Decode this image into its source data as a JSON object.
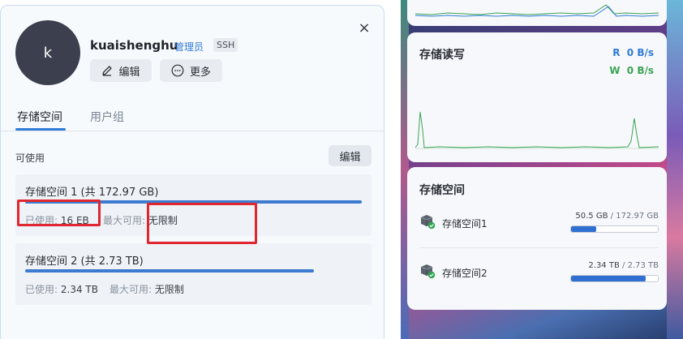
{
  "user_panel": {
    "avatar_letter": "k",
    "username": "kuaishenghu",
    "role_tag": "管理员",
    "ssh_tag": "SSH",
    "close_symbol": "×",
    "edit_button": "编辑",
    "more_button": "更多",
    "tabs": [
      {
        "label": "存储空间",
        "active": true
      },
      {
        "label": "用户组",
        "active": false
      }
    ],
    "available_label": "可使用",
    "edit_small_button": "编辑",
    "storage": [
      {
        "title": "存储空间 1 (共 172.97 GB)",
        "used_label": "已使用:",
        "used_value": "16 EB",
        "max_label": "最大可用:",
        "max_value": "无限制",
        "bar_fraction": 0.95
      },
      {
        "title": "存储空间 2 (共 2.73 TB)",
        "used_label": "已使用:",
        "used_value": "2.34 TB",
        "max_label": "最大可用:",
        "max_value": "无限制",
        "bar_fraction": 0.81
      }
    ]
  },
  "dashboard": {
    "io_widget": {
      "title": "存储读写",
      "read_label": "R",
      "read_value": "0 B/s",
      "write_label": "W",
      "write_value": "0 B/s"
    },
    "storage_widget": {
      "title": "存储空间",
      "volumes": [
        {
          "name": "存储空间1",
          "used": "50.5 GB",
          "total": "172.97 GB",
          "usage_fraction": 0.29
        },
        {
          "name": "存储空间2",
          "used": "2.34 TB",
          "total": "2.73 TB",
          "usage_fraction": 0.86
        }
      ]
    }
  },
  "colors": {
    "accent": "#2f7bd6",
    "write_green": "#3aa353",
    "highlight_red": "#e0262e",
    "bar_blue": "#3d7bd0"
  },
  "icons": {
    "close": "close-icon",
    "edit": "pencil-icon",
    "more": "more-dots-icon",
    "volume": "volume-check-icon"
  }
}
